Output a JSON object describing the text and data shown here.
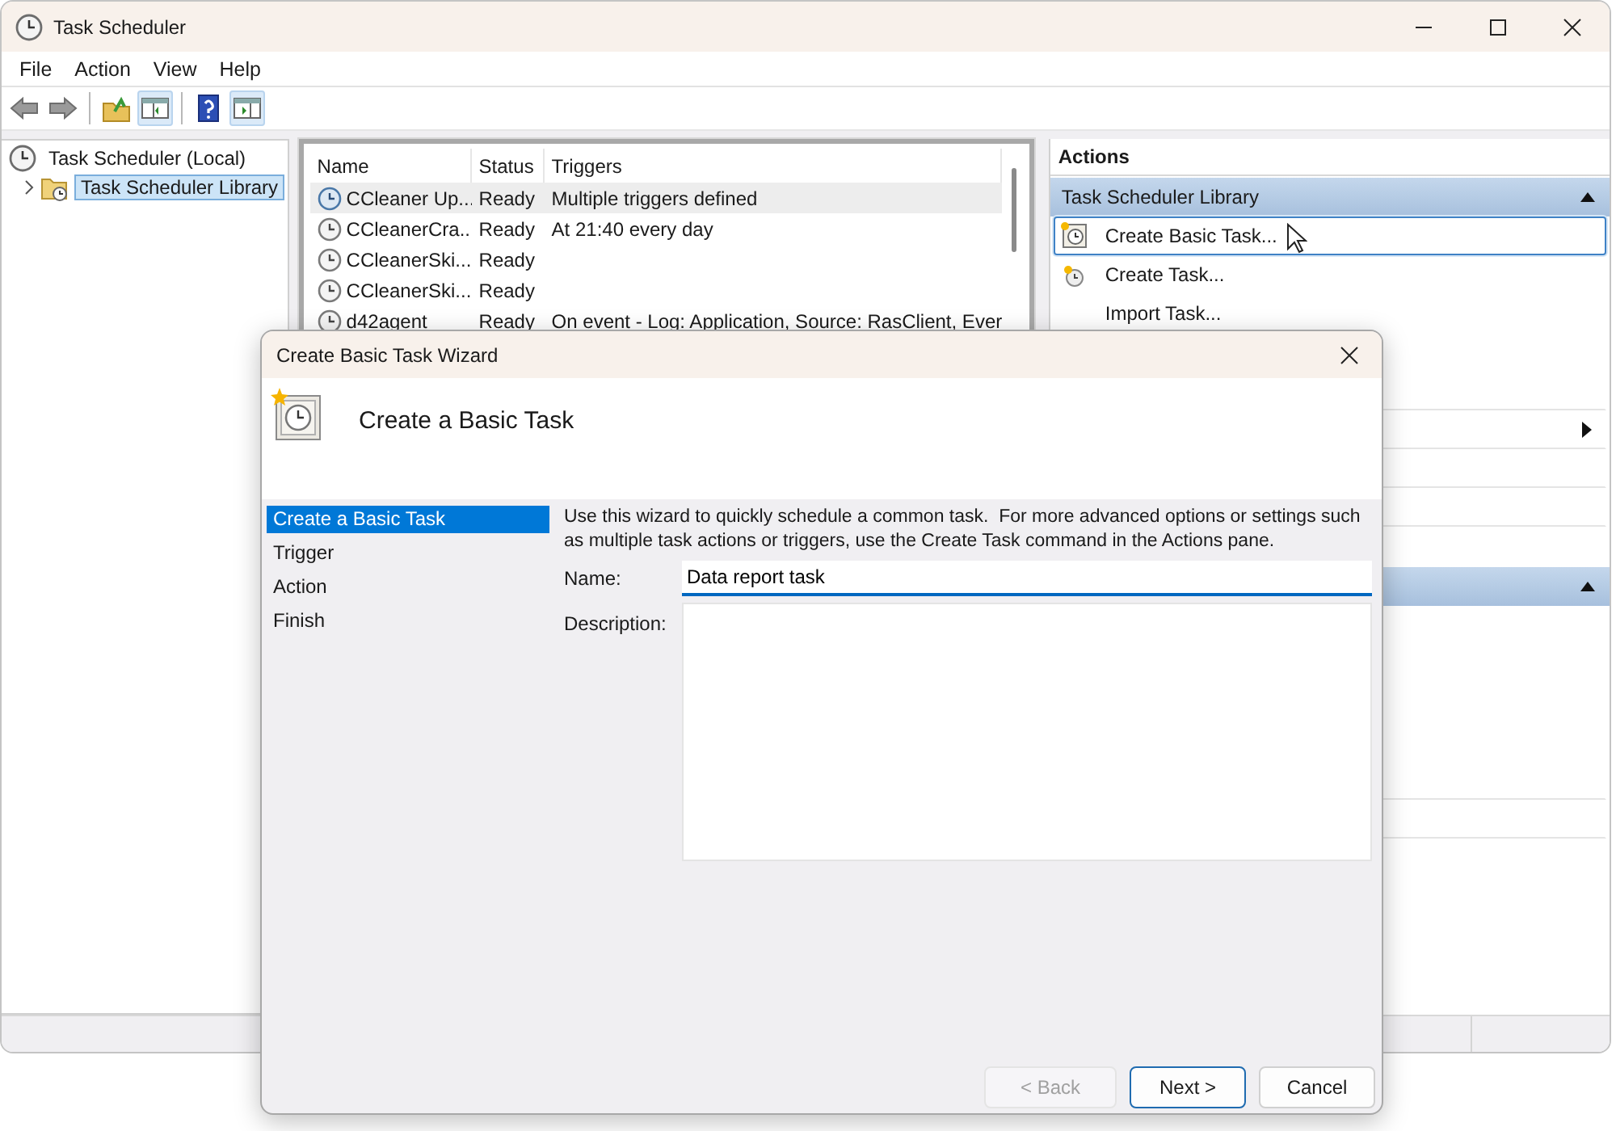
{
  "window": {
    "title": "Task Scheduler"
  },
  "menu": [
    {
      "label": "File"
    },
    {
      "label": "Action"
    },
    {
      "label": "View"
    },
    {
      "label": "Help"
    }
  ],
  "toolbar": [
    {
      "kind": "back",
      "selected": false
    },
    {
      "kind": "forward",
      "selected": false
    },
    {
      "kind": "sep"
    },
    {
      "kind": "up",
      "selected": false
    },
    {
      "kind": "tree",
      "selected": true
    },
    {
      "kind": "sep"
    },
    {
      "kind": "help",
      "selected": false
    },
    {
      "kind": "pane",
      "selected": true
    }
  ],
  "tree": [
    {
      "label": "Task Scheduler (Local)",
      "selected": false,
      "children": [
        {
          "label": "Task Scheduler Library",
          "selected": true,
          "expanded": false
        }
      ]
    }
  ],
  "tasks": {
    "columns": [
      "Name",
      "Status",
      "Triggers"
    ],
    "rows": [
      {
        "name": "CCleaner Up...",
        "status": "Ready",
        "triggers": "Multiple triggers defined",
        "selected": true
      },
      {
        "name": "CCleanerCra...",
        "status": "Ready",
        "triggers": "At 21:40 every day",
        "selected": false
      },
      {
        "name": "CCleanerSki...",
        "status": "Ready",
        "selected": false
      },
      {
        "name": "CCleanerSki...",
        "status": "Ready",
        "selected": false
      },
      {
        "name": "d42agent",
        "status": "Ready",
        "triggers": "On event - Log: Application, Source: RasClient, Ever",
        "selected": false
      }
    ]
  },
  "actions": {
    "title": "Actions",
    "sections": [
      {
        "title": "Task Scheduler Library",
        "expanded": true,
        "items": [
          {
            "kind": "wizard",
            "label": "Create Basic Task...",
            "selected": true
          },
          {
            "kind": "new",
            "label": "Create Task...",
            "selected": false
          },
          {
            "kind": "plain",
            "label": "Import Task...",
            "selected": false
          },
          {
            "kind": "blank"
          },
          {
            "kind": "divider"
          },
          {
            "kind": "divider",
            "submenu": true
          },
          {
            "kind": "divider"
          },
          {
            "kind": "divider"
          },
          {
            "kind": "blank"
          }
        ]
      },
      {
        "expanded": true,
        "items": [
          {
            "kind": "blank"
          },
          {
            "kind": "blank"
          },
          {
            "kind": "blank"
          },
          {
            "kind": "blank"
          },
          {
            "kind": "divider"
          },
          {
            "kind": "divider"
          }
        ]
      }
    ]
  },
  "wizard": {
    "title": "Create Basic Task Wizard",
    "heading": "Create a Basic Task",
    "steps": [
      {
        "label": "Create a Basic Task",
        "selected": true
      },
      {
        "label": "Trigger",
        "selected": false
      },
      {
        "label": "Action",
        "selected": false
      },
      {
        "label": "Finish",
        "selected": false
      }
    ],
    "intro": "Use this wizard to quickly schedule a common task.  For more advanced options or settings such as multiple task actions or triggers, use the Create Task command in the Actions pane.",
    "fields": [
      {
        "kind": "line",
        "label": "Name:",
        "value": "Data report task"
      },
      {
        "kind": "area",
        "label": "Description:"
      }
    ],
    "buttons": [
      {
        "label": "< Back",
        "disabled": true,
        "default": false
      },
      {
        "label": "Next >",
        "disabled": false,
        "default": true
      },
      {
        "label": "Cancel",
        "disabled": false,
        "default": false
      }
    ]
  }
}
